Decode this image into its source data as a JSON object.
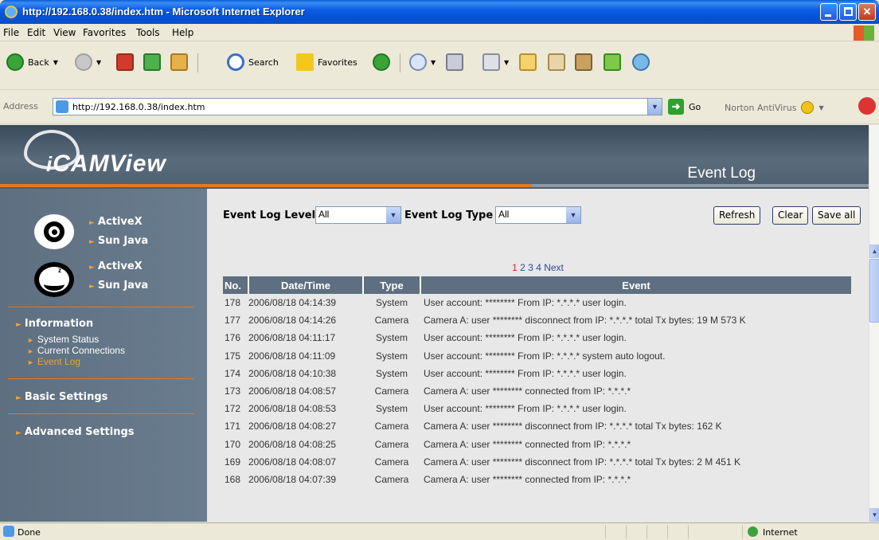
{
  "window": {
    "title": "http://192.168.0.38/index.htm - Microsoft Internet Explorer"
  },
  "menu": [
    "File",
    "Edit",
    "View",
    "Favorites",
    "Tools",
    "Help"
  ],
  "toolbar": {
    "back_label": "Back",
    "search_label": "Search",
    "favorites_label": "Favorites"
  },
  "address": {
    "label": "Address",
    "url": "http://192.168.0.38/index.htm",
    "go_label": "Go",
    "norton_label": "Norton AntiVirus"
  },
  "banner": {
    "logo_prefix": "i",
    "logo_text": "CAMView",
    "page_title": "Event Log"
  },
  "sidebar": {
    "viewer_links": [
      "ActiveX",
      "Sun Java",
      "ActiveX",
      "Sun Java"
    ],
    "information": {
      "label": "Information",
      "items": [
        "System Status",
        "Current Connections",
        "Event Log"
      ]
    },
    "basic_settings": "Basic Settings",
    "advanced_settings": "Advanced Settings"
  },
  "filters": {
    "level_label": "Event Log Level",
    "level_value": "All",
    "type_label": "Event Log Type",
    "type_value": "All",
    "refresh_label": "Refresh",
    "clear_label": "Clear",
    "save_label": "Save all"
  },
  "pager": {
    "current": "1",
    "pages": [
      "2",
      "3",
      "4"
    ],
    "next_label": "Next"
  },
  "log": {
    "headers": [
      "No.",
      "Date/Time",
      "Type",
      "Event"
    ],
    "rows": [
      {
        "no": "178",
        "datetime": "2006/08/18 04:14:39",
        "type": "System",
        "event": "User account: ******** From IP: *.*.*.* user login."
      },
      {
        "no": "177",
        "datetime": "2006/08/18 04:14:26",
        "type": "Camera",
        "event": "Camera A: user ******** disconnect from IP: *.*.*.* total Tx bytes: 19 M 573 K"
      },
      {
        "no": "176",
        "datetime": "2006/08/18 04:11:17",
        "type": "System",
        "event": "User account: ******** From IP: *.*.*.* user login."
      },
      {
        "no": "175",
        "datetime": "2006/08/18 04:11:09",
        "type": "System",
        "event": "User account: ******** From IP: *.*.*.* system auto logout."
      },
      {
        "no": "174",
        "datetime": "2006/08/18 04:10:38",
        "type": "System",
        "event": "User account: ******** From IP: *.*.*.* user login."
      },
      {
        "no": "173",
        "datetime": "2006/08/18 04:08:57",
        "type": "Camera",
        "event": "Camera A: user ******** connected from IP: *.*.*.*"
      },
      {
        "no": "172",
        "datetime": "2006/08/18 04:08:53",
        "type": "System",
        "event": "User account: ******** From IP: *.*.*.* user login."
      },
      {
        "no": "171",
        "datetime": "2006/08/18 04:08:27",
        "type": "Camera",
        "event": "Camera A: user ******** disconnect from IP: *.*.*.* total Tx bytes: 162 K"
      },
      {
        "no": "170",
        "datetime": "2006/08/18 04:08:25",
        "type": "Camera",
        "event": "Camera A: user ******** connected from IP: *.*.*.*"
      },
      {
        "no": "169",
        "datetime": "2006/08/18 04:08:07",
        "type": "Camera",
        "event": "Camera A: user ******** disconnect from IP: *.*.*.* total Tx bytes: 2 M 451 K"
      },
      {
        "no": "168",
        "datetime": "2006/08/18 04:07:39",
        "type": "Camera",
        "event": "Camera A: user ******** connected from IP: *.*.*.*"
      }
    ]
  },
  "status": {
    "text": "Done",
    "zone": "Internet"
  }
}
